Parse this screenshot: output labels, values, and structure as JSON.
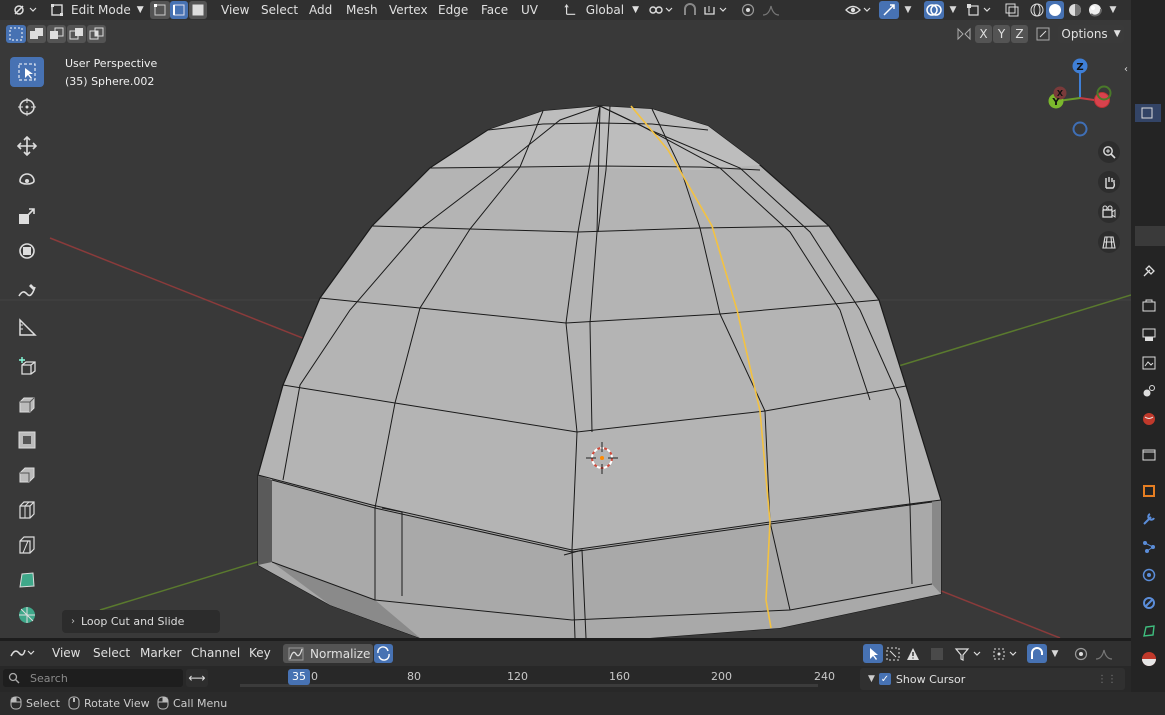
{
  "header": {
    "mode_label": "Edit Mode",
    "menus": [
      "View",
      "Select",
      "Add",
      "Mesh",
      "Vertex",
      "Edge",
      "Face",
      "UV"
    ],
    "orientation_label": "Global",
    "axis_x": "X",
    "axis_y": "Y",
    "axis_z": "Z",
    "options_label": "Options"
  },
  "viewport": {
    "perspective_label": "User Perspective",
    "object_label": "(35) Sphere.002",
    "operator_panel_label": "Loop Cut and Slide",
    "gizmo": {
      "z": "Z",
      "y": "Y",
      "x": "X"
    }
  },
  "timeline": {
    "menus": [
      "View",
      "Select",
      "Marker",
      "Channel",
      "Key"
    ],
    "normalize_label": "Normalize",
    "search_placeholder": "Search",
    "current_frame": "35",
    "ruler_ticks": [
      "0",
      "80",
      "120",
      "160",
      "200",
      "240"
    ],
    "show_cursor_label": "Show Cursor"
  },
  "status": {
    "select": "Select",
    "rotate_view": "Rotate View",
    "call_menu": "Call Menu"
  },
  "colors": {
    "accent": "#4772b3",
    "selected_edge": "#f3c242",
    "background": "#393939"
  }
}
